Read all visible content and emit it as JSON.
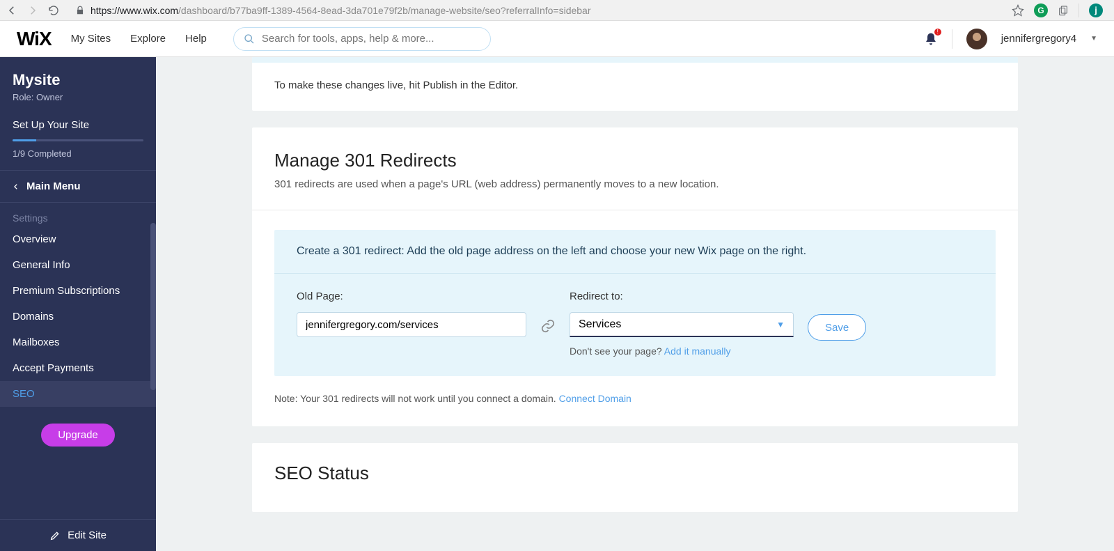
{
  "browser": {
    "url_proto": "https://",
    "url_host": "www.wix.com",
    "url_path": "/dashboard/b77ba9ff-1389-4564-8ead-3da701e79f2b/manage-website/seo?referralInfo=sidebar",
    "ext_letter": "G",
    "profile_letter": "j"
  },
  "header": {
    "logo": "WiX",
    "nav": {
      "mysites": "My Sites",
      "explore": "Explore",
      "help": "Help"
    },
    "search_placeholder": "Search for tools, apps, help & more...",
    "notif_badge": "!",
    "username": "jennifergregory4"
  },
  "sidebar": {
    "site_name": "Mysite",
    "role": "Role: Owner",
    "setup_title": "Set Up Your Site",
    "completed": "1/9 Completed",
    "main_menu": "Main Menu",
    "section": "Settings",
    "items": {
      "overview": "Overview",
      "general": "General Info",
      "premium": "Premium Subscriptions",
      "domains": "Domains",
      "mailboxes": "Mailboxes",
      "payments": "Accept Payments",
      "seo": "SEO"
    },
    "upgrade": "Upgrade",
    "edit_site": "Edit Site"
  },
  "main": {
    "publish_note": "To make these changes live, hit Publish in the Editor.",
    "redirects": {
      "title": "Manage 301 Redirects",
      "subtitle": "301 redirects are used when a page's URL (web address) permanently moves to a new location.",
      "instruction": "Create a 301 redirect: Add the old page address on the left and choose your new Wix page on the right.",
      "old_label": "Old Page:",
      "old_value": "jennifergregory.com/services",
      "redirect_label": "Redirect to:",
      "redirect_value": "Services",
      "hint_text": "Don't see your page? ",
      "hint_link": "Add it manually",
      "save": "Save",
      "footnote_text": "Note: Your 301 redirects will not work until you connect a domain. ",
      "footnote_link": "Connect Domain"
    },
    "status": {
      "title": "SEO Status"
    }
  }
}
